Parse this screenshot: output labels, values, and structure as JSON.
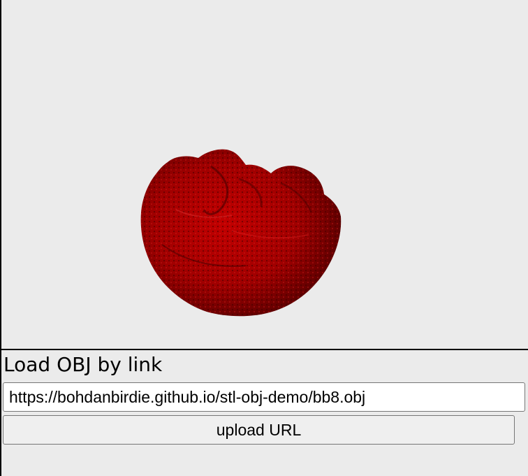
{
  "viewer": {
    "model": "red 3D mesh",
    "background": "#ebebeb",
    "model_color": "#b40000"
  },
  "form": {
    "title": "Load OBJ by link",
    "url_value": "https://bohdanbirdie.github.io/stl-obj-demo/bb8.obj",
    "upload_label": "upload URL"
  }
}
